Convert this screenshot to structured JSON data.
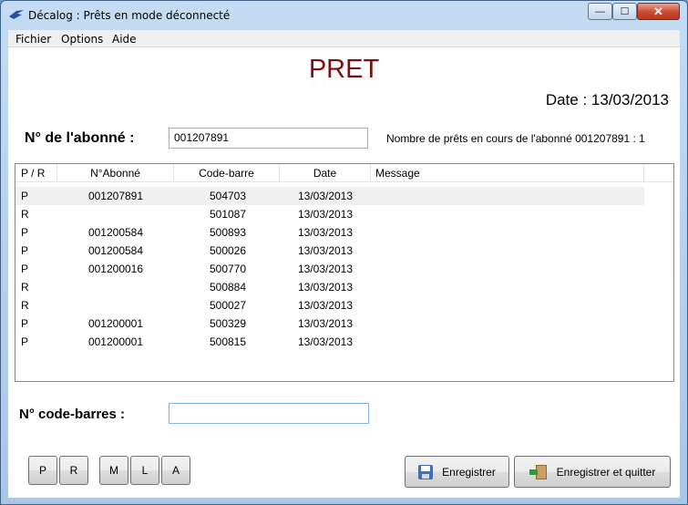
{
  "window": {
    "title": "Décalog : Prêts en mode déconnecté",
    "controls": {
      "minimize": "—",
      "maximize": "☐",
      "close": "✕"
    }
  },
  "menu": [
    "Fichier",
    "Options",
    "Aide"
  ],
  "header": {
    "title": "PRET",
    "date_text": "Date : 13/03/2013"
  },
  "subscriber": {
    "label": "N° de l'abonné :",
    "value": "001207891",
    "loans_info": "Nombre de prêts en cours de l'abonné 001207891 : 1"
  },
  "table": {
    "columns": [
      "P / R",
      "N°Abonné",
      "Code-barre",
      "Date",
      "Message"
    ],
    "rows": [
      {
        "pr": "P",
        "abonne": "001207891",
        "code": "504703",
        "date": "13/03/2013",
        "message": ""
      },
      {
        "pr": "R",
        "abonne": "",
        "code": "501087",
        "date": "13/03/2013",
        "message": ""
      },
      {
        "pr": "P",
        "abonne": "001200584",
        "code": "500893",
        "date": "13/03/2013",
        "message": ""
      },
      {
        "pr": "P",
        "abonne": "001200584",
        "code": "500026",
        "date": "13/03/2013",
        "message": ""
      },
      {
        "pr": "P",
        "abonne": "001200016",
        "code": "500770",
        "date": "13/03/2013",
        "message": ""
      },
      {
        "pr": "R",
        "abonne": "",
        "code": "500884",
        "date": "13/03/2013",
        "message": ""
      },
      {
        "pr": "R",
        "abonne": "",
        "code": "500027",
        "date": "13/03/2013",
        "message": ""
      },
      {
        "pr": "P",
        "abonne": "001200001",
        "code": "500329",
        "date": "13/03/2013",
        "message": ""
      },
      {
        "pr": "P",
        "abonne": "001200001",
        "code": "500815",
        "date": "13/03/2013",
        "message": ""
      }
    ]
  },
  "barcode": {
    "label": "N° code-barres :",
    "value": ""
  },
  "mode_buttons": [
    "P",
    "R",
    "M",
    "L",
    "A"
  ],
  "actions": {
    "save": "Enregistrer",
    "save_quit": "Enregistrer et quitter"
  },
  "colors": {
    "title": "#7a1010",
    "selected_row": "#f0f0f0"
  }
}
